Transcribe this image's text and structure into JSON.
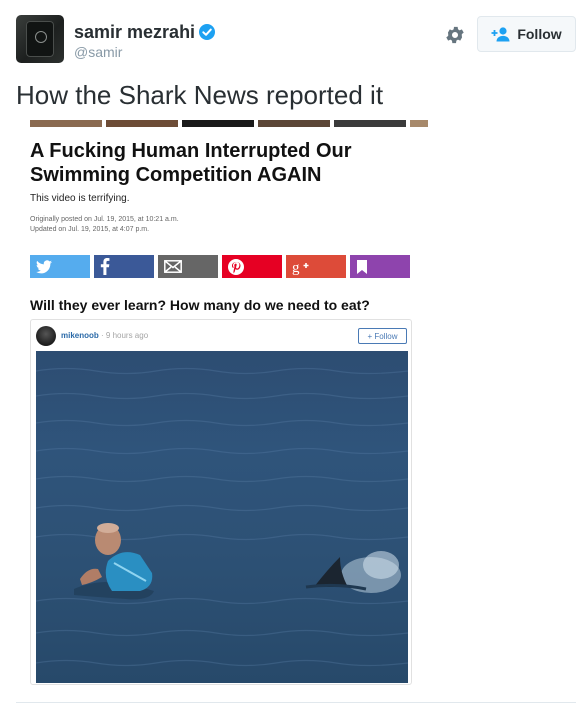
{
  "author": {
    "name": "samir mezrahi",
    "handle": "@samir"
  },
  "follow_button": {
    "label": "Follow"
  },
  "tweet": {
    "text": "How the Shark News reported it"
  },
  "article": {
    "headline": "A Fucking Human Interrupted Our Swimming Competition AGAIN",
    "dek": "This video is terrifying.",
    "posted": "Originally posted on Jul. 19, 2015, at 10:21 a.m.",
    "updated": "Updated on Jul. 19, 2015, at 4:07 p.m.",
    "share_buttons": [
      {
        "icon": "twitter-icon",
        "color": "#55acee"
      },
      {
        "icon": "facebook-icon",
        "color": "#3b5998"
      },
      {
        "icon": "email-icon",
        "color": "#666666"
      },
      {
        "icon": "pinterest-icon",
        "color": "#e60023"
      },
      {
        "icon": "google-plus-icon",
        "color": "#dd4b39"
      },
      {
        "icon": "bookmark-icon",
        "color": "#8e44ad"
      }
    ],
    "question": "Will they ever learn? How many do we need to eat?",
    "embed": {
      "user": "mikenoob",
      "time": "· 9 hours ago",
      "follow_label": "+ Follow"
    }
  },
  "colors": {
    "verified": "#1da1f2",
    "link": "#2b6aa8",
    "text": "#292f33",
    "muted": "#8899a6"
  }
}
